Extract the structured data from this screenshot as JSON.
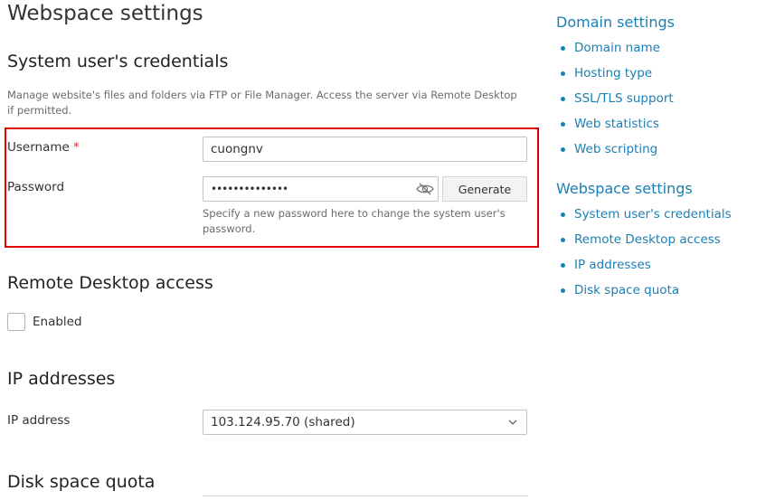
{
  "page": {
    "title": "Webspace settings"
  },
  "credentials": {
    "title": "System user's credentials",
    "description": "Manage website's files and folders via FTP or File Manager. Access the server via Remote Desktop if permitted.",
    "username_label": "Username",
    "required_mark": "*",
    "username_value": "cuongnv",
    "password_label": "Password",
    "password_value": "••••••••••••••",
    "generate_label": "Generate",
    "password_hint": "Specify a new password here to change the system user's password."
  },
  "remote_desktop": {
    "title": "Remote Desktop access",
    "enabled_label": "Enabled",
    "enabled": false
  },
  "ip": {
    "title": "IP addresses",
    "label": "IP address",
    "selected": "103.124.95.70 (shared)"
  },
  "quota": {
    "title": "Disk space quota"
  },
  "sidebar": {
    "domain_title": "Domain settings",
    "domain_items": [
      {
        "label": "Domain name"
      },
      {
        "label": "Hosting type"
      },
      {
        "label": "SSL/TLS support"
      },
      {
        "label": "Web statistics"
      },
      {
        "label": "Web scripting"
      }
    ],
    "webspace_title": "Webspace settings",
    "webspace_items": [
      {
        "label": "System user's credentials"
      },
      {
        "label": "Remote Desktop access"
      },
      {
        "label": "IP addresses"
      },
      {
        "label": "Disk space quota"
      }
    ]
  },
  "colors": {
    "link": "#1a7fb3",
    "highlight_border": "#e00000",
    "required": "#d02b2b"
  },
  "icons": {
    "password_toggle": "eye-slash-icon",
    "select_arrow": "chevron-down-icon"
  }
}
